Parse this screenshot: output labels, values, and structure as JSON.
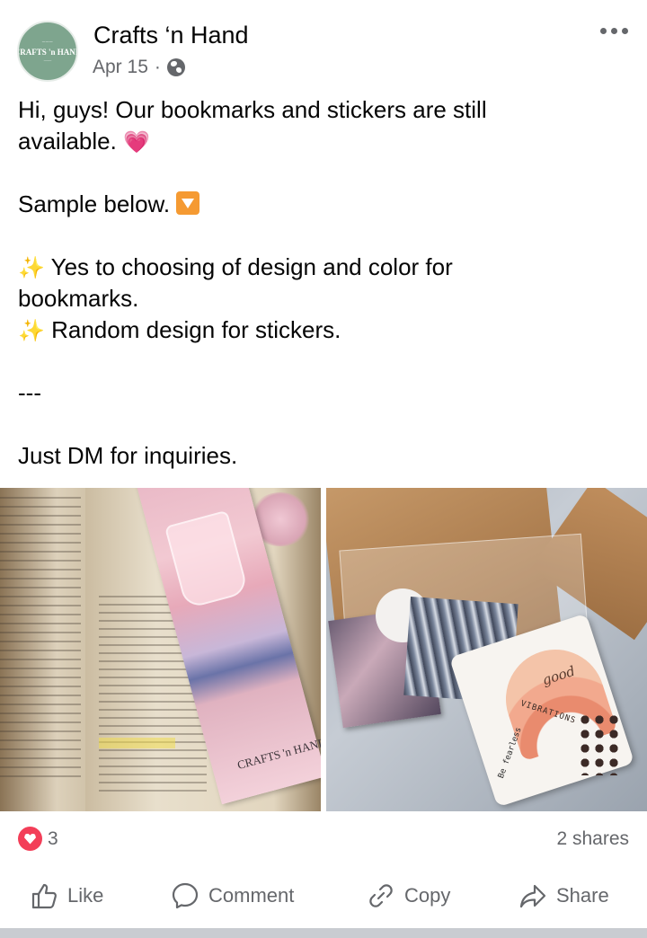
{
  "post": {
    "page_name": "Crafts ‘n Hand",
    "avatar_logo": "CRAFTS 'n HAND",
    "date": "Apr 15",
    "separator": "·",
    "audience_icon": "globe-icon",
    "more_icon": "more-options-icon",
    "lines": {
      "l1": "Hi, guys! Our bookmarks and stickers are still",
      "l2": "available.",
      "l2_emoji": "💗",
      "l4": "Sample below.",
      "l6_sparkle": "✨",
      "l6": " Yes to choosing of design and color for",
      "l7": "bookmarks.",
      "l8_sparkle": "✨",
      "l8": " Random design for stickers.",
      "l10": "---",
      "l12": "Just DM for inquiries."
    }
  },
  "photos": {
    "left": {
      "desc_icon": "bookmark-photo",
      "logo_text": "CRAFTS 'n HAND"
    },
    "right": {
      "desc_icon": "stickers-photo",
      "good_text": "good",
      "vibrations_text": "VIBRATIONS",
      "fearless_text": "Be fearless"
    }
  },
  "stats": {
    "reaction_icon": "heart-reaction-icon",
    "reaction_count": "3",
    "shares": "2 shares"
  },
  "actions": {
    "like": "Like",
    "comment": "Comment",
    "copy": "Copy",
    "share": "Share"
  },
  "colors": {
    "reaction_heart": "#f33e58",
    "secondary_text": "#65676b",
    "avatar_bg": "#7ea58e"
  }
}
